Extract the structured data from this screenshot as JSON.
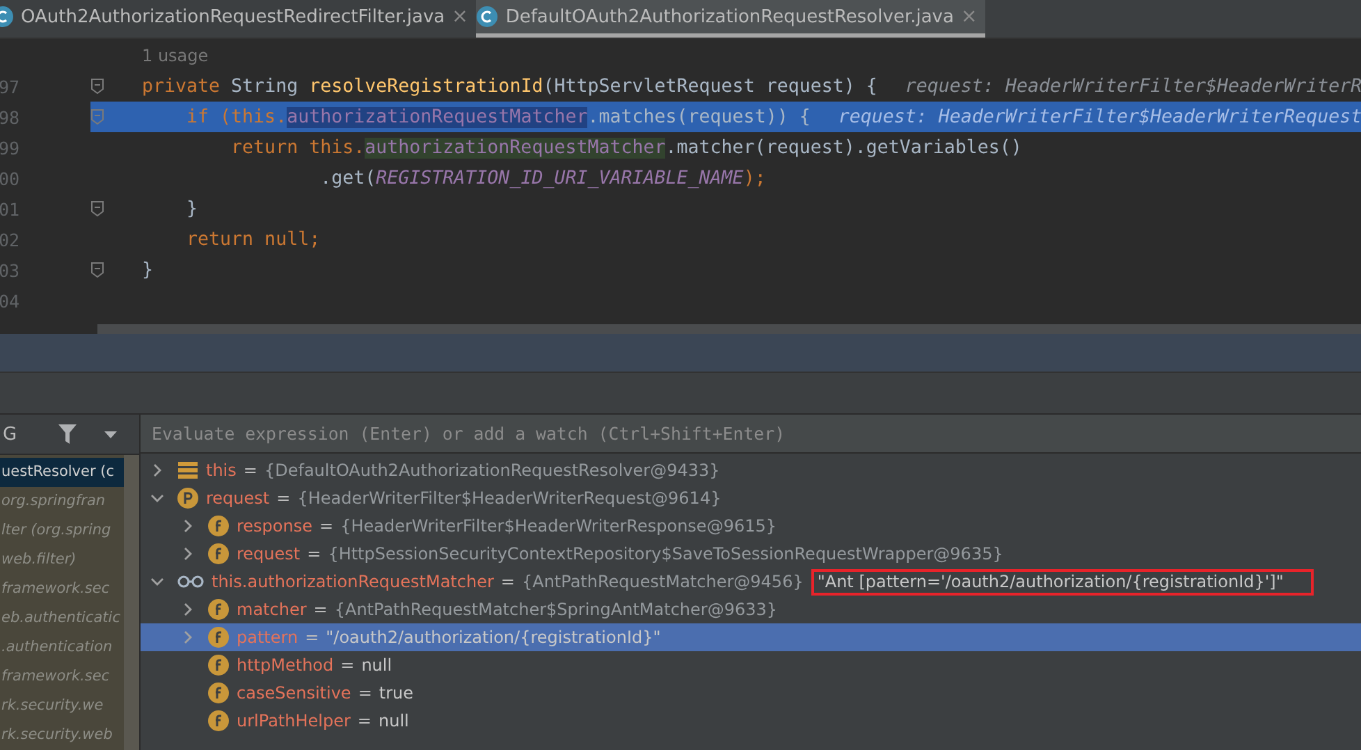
{
  "tabs": [
    {
      "label": "OAuth2AuthorizationRequestRedirectFilter.java",
      "close": "×",
      "selected": false
    },
    {
      "label": "DefaultOAuth2AuthorizationRequestResolver.java",
      "close": "×",
      "selected": true
    }
  ],
  "editor": {
    "lines": [
      {
        "usage": "1 usage",
        "fold": false,
        "current": false
      },
      {
        "number": "97",
        "fold": true,
        "current": false,
        "tokens": [
          {
            "text": "private ",
            "kind": "keyword"
          },
          {
            "text": "String ",
            "kind": "plain"
          },
          {
            "text": "resolveRegistrationId",
            "kind": "declaration"
          },
          {
            "text": "(HttpServletRequest request) {",
            "kind": "plain"
          }
        ],
        "hint": "request: HeaderWriterFilter$HeaderWriterR"
      },
      {
        "number": "98",
        "fold": true,
        "current": true,
        "tokens": [
          {
            "text": "    if (this.",
            "kind": "keyword"
          },
          {
            "text": "authorizationRequestMatcher",
            "kind": "fieldread"
          },
          {
            "text": ".matches(request)) {",
            "kind": "plain"
          }
        ],
        "hint": "request: HeaderWriterFilter$HeaderWriterRequest"
      },
      {
        "number": "99",
        "fold": false,
        "current": false,
        "tokens": [
          {
            "text": "        return this.",
            "kind": "keyword"
          },
          {
            "text": "authorizationRequestMatcher",
            "kind": "fieldusage"
          },
          {
            "text": ".matcher(request).getVariables()",
            "kind": "plain"
          }
        ]
      },
      {
        "number": "00",
        "fold": false,
        "current": false,
        "tokens": [
          {
            "text": "                .get(",
            "kind": "plain"
          },
          {
            "text": "REGISTRATION_ID_URI_VARIABLE_NAME",
            "kind": "constant"
          },
          {
            "text": ");",
            "kind": "keyword"
          }
        ]
      },
      {
        "number": "01",
        "fold": true,
        "current": false,
        "tokens": [
          {
            "text": "    }",
            "kind": "plain"
          }
        ]
      },
      {
        "number": "02",
        "fold": false,
        "current": false,
        "tokens": [
          {
            "text": "    return null;",
            "kind": "keyword"
          }
        ]
      },
      {
        "number": "03",
        "fold": true,
        "current": false,
        "tokens": [
          {
            "text": "}",
            "kind": "plain"
          }
        ]
      },
      {
        "number": "04",
        "fold": false,
        "current": false
      }
    ]
  },
  "frames": {
    "title": "G",
    "items": [
      {
        "text": "uestResolver (c",
        "selected": true
      },
      {
        "text": "org.springfran",
        "selected": false
      },
      {
        "text": "lter (org.spring",
        "selected": false
      },
      {
        "text": "web.filter)",
        "selected": false
      },
      {
        "text": "framework.sec",
        "selected": false
      },
      {
        "text": "eb.authenticatic",
        "selected": false
      },
      {
        "text": ".authentication",
        "selected": false
      },
      {
        "text": "framework.sec",
        "selected": false
      },
      {
        "text": "rk.security.we",
        "selected": false
      },
      {
        "text": "rk.security.web",
        "selected": false
      }
    ]
  },
  "variables": {
    "placeholder": "Evaluate expression (Enter) or add a watch (Ctrl+Shift+Enter)",
    "items": [
      {
        "kind": "object",
        "name": "this",
        "operator": "=",
        "value": "{DefaultOAuth2AuthorizationRequestResolver@9433}",
        "expanded": false,
        "selected": false
      },
      {
        "kind": "param",
        "name": "request",
        "operator": "=",
        "value": "{HeaderWriterFilter$HeaderWriterRequest@9614}",
        "expanded": true,
        "selected": false,
        "children": [
          {
            "kind": "field",
            "name": "response",
            "operator": "=",
            "value": "{HeaderWriterFilter$HeaderWriterResponse@9615}",
            "expanded": false,
            "selected": false
          },
          {
            "kind": "field",
            "name": "request",
            "operator": "=",
            "value": "{HttpSessionSecurityContextRepository$SaveToSessionRequestWrapper@9635}",
            "expanded": false,
            "selected": false
          }
        ]
      },
      {
        "kind": "watch",
        "name": "this.authorizationRequestMatcher",
        "operator": "=",
        "value": "{AntPathRequestMatcher@9456}",
        "to_string": "\"Ant [pattern='/oauth2/authorization/{registrationId}']\"",
        "annotated": true,
        "expanded": true,
        "selected": false,
        "children": [
          {
            "kind": "field",
            "name": "matcher",
            "operator": "=",
            "value": "{AntPathRequestMatcher$SpringAntMatcher@9633}",
            "expanded": false,
            "selected": false
          },
          {
            "kind": "field",
            "name": "pattern",
            "operator": "=",
            "value": "\"/oauth2/authorization/{registrationId}\"",
            "expanded": false,
            "selected": true
          },
          {
            "kind": "field",
            "name": "httpMethod",
            "operator": "=",
            "value": "null",
            "selected": false
          },
          {
            "kind": "field",
            "name": "caseSensitive",
            "operator": "=",
            "value": "true",
            "selected": false
          },
          {
            "kind": "field",
            "name": "urlPathHelper",
            "operator": "=",
            "value": "null",
            "selected": false
          }
        ]
      }
    ]
  }
}
